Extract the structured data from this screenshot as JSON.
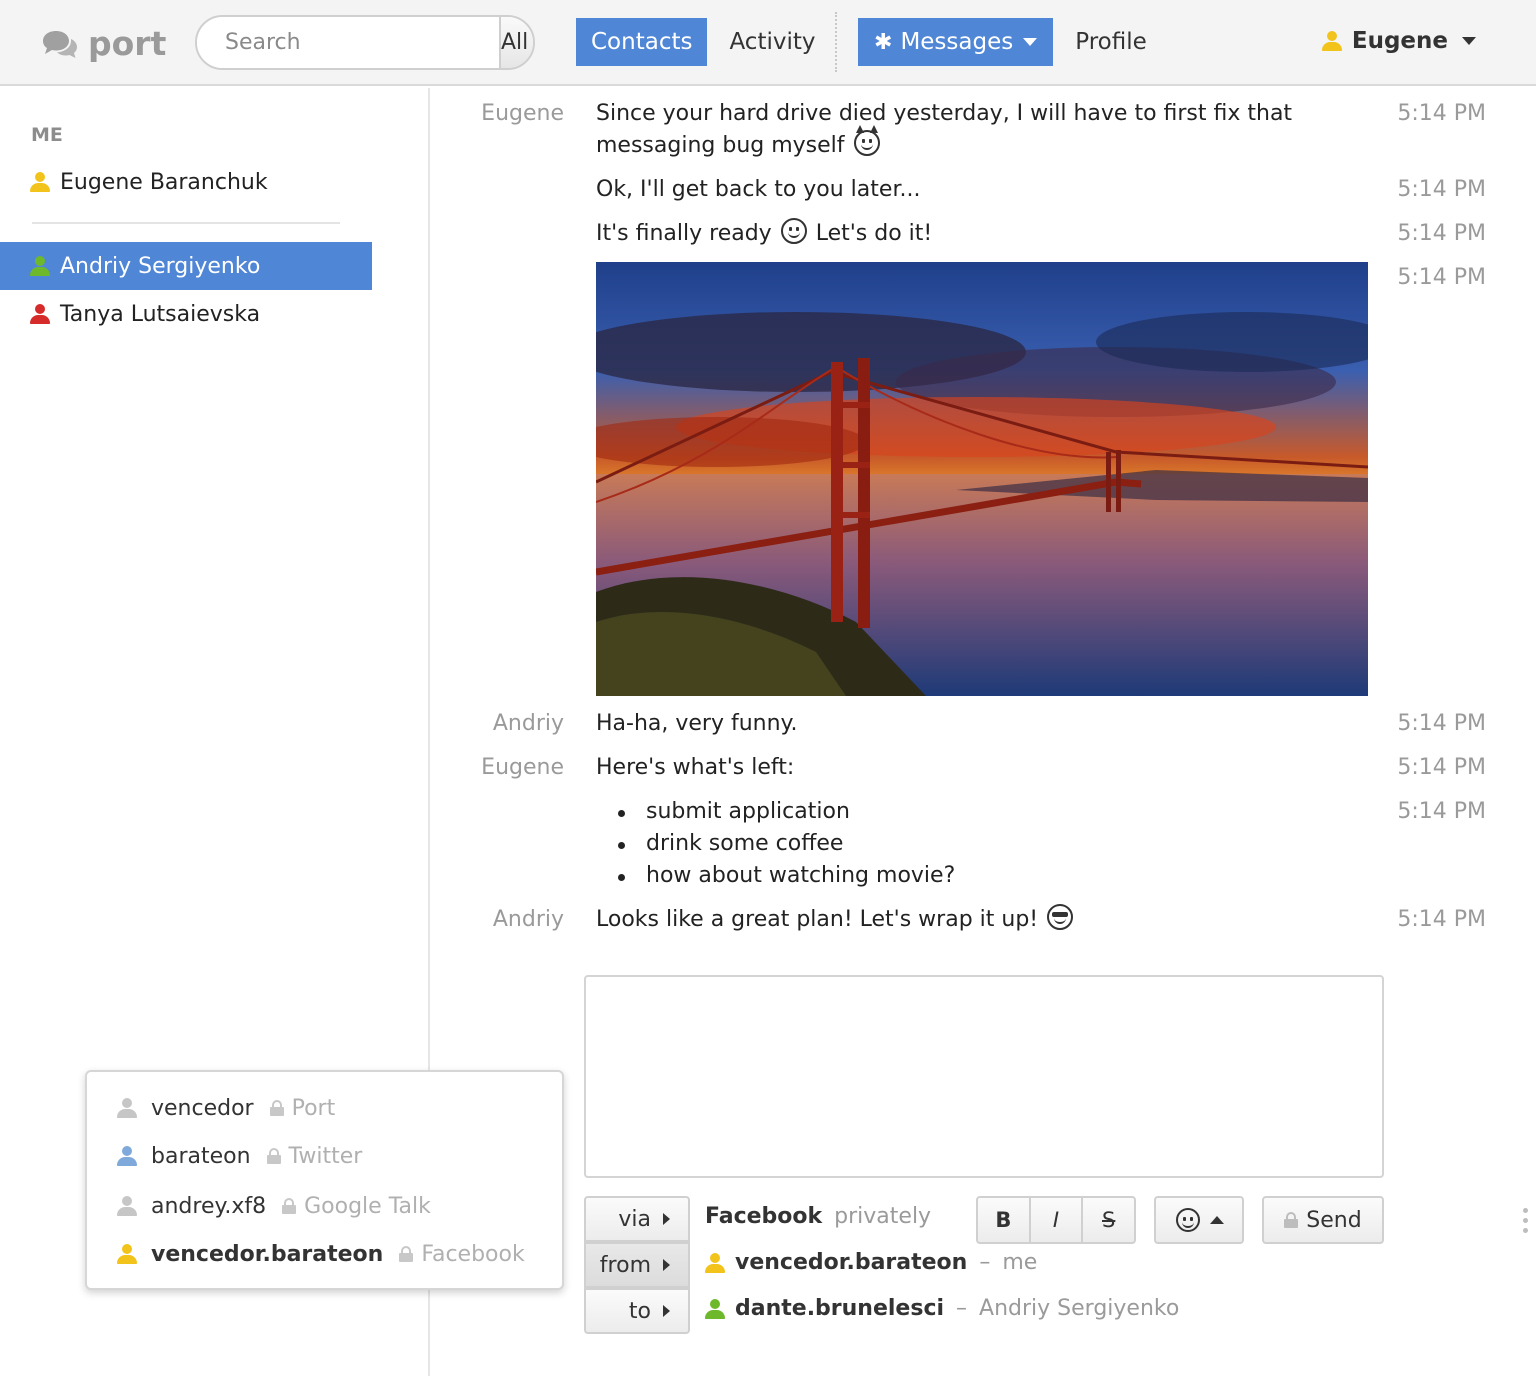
{
  "header": {
    "logo_text": "port",
    "search": {
      "placeholder": "Search",
      "filter_label": "All"
    },
    "nav": {
      "contacts": "Contacts",
      "activity": "Activity",
      "messages": "Messages",
      "profile": "Profile"
    },
    "user_name": "Eugene"
  },
  "sidebar": {
    "me_label": "ME",
    "me": "Eugene Baranchuk",
    "contacts": [
      "Andriy Sergiyenko",
      "Tanya Lutsaievska"
    ]
  },
  "messages": [
    {
      "sender": "Eugene",
      "text": "Since your hard drive died yesterday, I will have to first fix that messaging bug myself",
      "time": "5:14 PM"
    },
    {
      "text": "Ok, I'll get back to you later...",
      "time": "5:14 PM"
    },
    {
      "text_before": "It's finally ready",
      "text_after": "Let's do it!",
      "time": "5:14 PM"
    },
    {
      "time": "5:14 PM"
    },
    {
      "sender": "Andriy",
      "text": "Ha-ha, very funny.",
      "time": "5:14 PM"
    },
    {
      "sender": "Eugene",
      "text": "Here's what's left:",
      "time": "5:14 PM"
    },
    {
      "items": [
        "submit application",
        "drink some coffee",
        "how about watching movie?"
      ],
      "time": "5:14 PM"
    },
    {
      "sender": "Andriy",
      "text": "Looks like a great plan! Let's wrap it up!",
      "time": "5:14 PM"
    }
  ],
  "composer": {
    "via_label": "via",
    "from_label": "from",
    "to_label": "to",
    "via_service": "Facebook",
    "via_mode": "privately",
    "from_account": "vencedor.barateon",
    "from_note": "me",
    "to_account": "dante.brunelesci",
    "to_note": "Andriy Sergiyenko",
    "bold_label": "B",
    "italic_label": "I",
    "strike_label": "S",
    "send_label": "Send"
  },
  "account_popup": [
    {
      "account": "vencedor",
      "service": "Port"
    },
    {
      "account": "barateon",
      "service": "Twitter"
    },
    {
      "account": "andrey.xf8",
      "service": "Google Talk"
    },
    {
      "account": "vencedor.barateon",
      "service": "Facebook"
    }
  ],
  "colors": {
    "accent": "#4f86d6",
    "online": "#6eb82c",
    "away": "#f2c31b",
    "busy": "#d62b2b"
  }
}
